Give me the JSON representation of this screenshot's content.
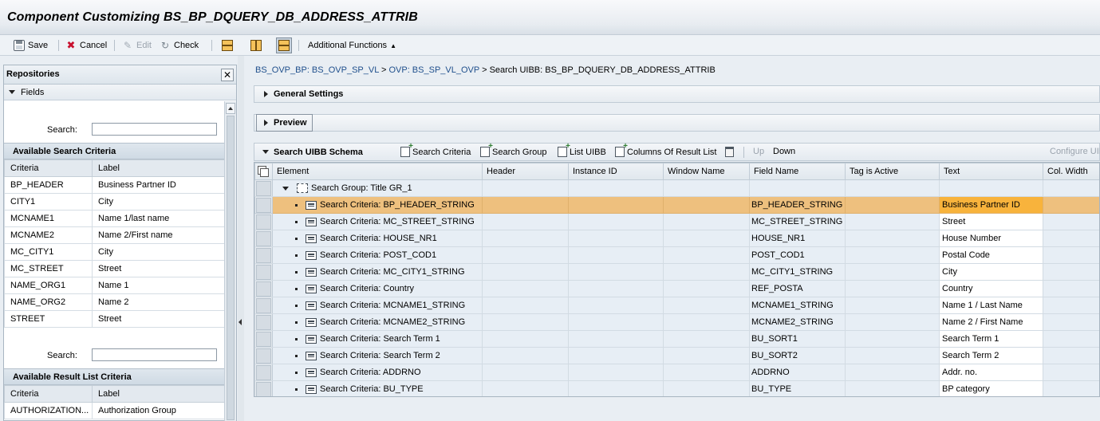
{
  "window": {
    "title": "Component Customizing BS_BP_DQUERY_DB_ADDRESS_ATTRIB"
  },
  "toolbar": {
    "save": "Save",
    "cancel": "Cancel",
    "edit": "Edit",
    "check": "Check",
    "additional": "Additional Functions"
  },
  "repositories": {
    "title": "Repositories",
    "fields": "Fields",
    "search_label": "Search:",
    "search_criteria_title": "Available Search Criteria",
    "result_list_title": "Available Result List Criteria",
    "col_criteria": "Criteria",
    "col_label": "Label",
    "search_criteria": [
      {
        "criteria": "BP_HEADER",
        "label": "Business Partner ID"
      },
      {
        "criteria": "CITY1",
        "label": "City"
      },
      {
        "criteria": "MCNAME1",
        "label": "Name 1/last name"
      },
      {
        "criteria": "MCNAME2",
        "label": "Name 2/First name"
      },
      {
        "criteria": "MC_CITY1",
        "label": "City"
      },
      {
        "criteria": "MC_STREET",
        "label": "Street"
      },
      {
        "criteria": "NAME_ORG1",
        "label": "Name 1"
      },
      {
        "criteria": "NAME_ORG2",
        "label": "Name 2"
      },
      {
        "criteria": "STREET",
        "label": "Street"
      }
    ],
    "result_criteria": [
      {
        "criteria": "AUTHORIZATION...",
        "label": "Authorization Group"
      }
    ]
  },
  "breadcrumb": {
    "link1": "BS_OVP_BP: BS_OVP_SP_VL",
    "link2": "OVP: BS_SP_VL_OVP",
    "current": "Search UIBB: BS_BP_DQUERY_DB_ADDRESS_ATTRIB",
    "sep": ">"
  },
  "panels": {
    "general": "General Settings",
    "preview": "Preview",
    "schema": "Search UIBB Schema"
  },
  "schema_toolbar": {
    "search_criteria": "Search Criteria",
    "search_group": "Search Group",
    "list_uibb": "List UIBB",
    "columns": "Columns Of Result List",
    "up": "Up",
    "down": "Down",
    "configure": "Configure UIBB"
  },
  "grid": {
    "columns": [
      "Element",
      "Header",
      "Instance ID",
      "Window Name",
      "Field Name",
      "Tag is Active",
      "Text",
      "Col. Width"
    ],
    "group_row": "Search Group: Title GR_1",
    "rows": [
      {
        "element": "Search Criteria: BP_HEADER_STRING",
        "field": "BP_HEADER_STRING",
        "text": "Business Partner ID"
      },
      {
        "element": "Search Criteria: MC_STREET_STRING",
        "field": "MC_STREET_STRING",
        "text": "Street"
      },
      {
        "element": "Search Criteria: HOUSE_NR1",
        "field": "HOUSE_NR1",
        "text": "House Number"
      },
      {
        "element": "Search Criteria: POST_COD1",
        "field": "POST_COD1",
        "text": "Postal Code"
      },
      {
        "element": "Search Criteria: MC_CITY1_STRING",
        "field": "MC_CITY1_STRING",
        "text": "City"
      },
      {
        "element": "Search Criteria: Country",
        "field": "REF_POSTA",
        "text": "Country"
      },
      {
        "element": "Search Criteria: MCNAME1_STRING",
        "field": "MCNAME1_STRING",
        "text": "Name 1 / Last Name"
      },
      {
        "element": "Search Criteria: MCNAME2_STRING",
        "field": "MCNAME2_STRING",
        "text": "Name 2 / First Name"
      },
      {
        "element": "Search Criteria: Search Term 1",
        "field": "BU_SORT1",
        "text": "Search Term 1"
      },
      {
        "element": "Search Criteria: Search Term 2",
        "field": "BU_SORT2",
        "text": "Search Term 2"
      },
      {
        "element": "Search Criteria: ADDRNO",
        "field": "ADDRNO",
        "text": "Addr. no."
      },
      {
        "element": "Search Criteria: BU_TYPE",
        "field": "BU_TYPE",
        "text": "BP category"
      }
    ],
    "selected_row": 0
  },
  "colors": {
    "highlight_row": "#eec07e",
    "highlight_text": "#f8b33c",
    "link": "#1f4f8c"
  }
}
